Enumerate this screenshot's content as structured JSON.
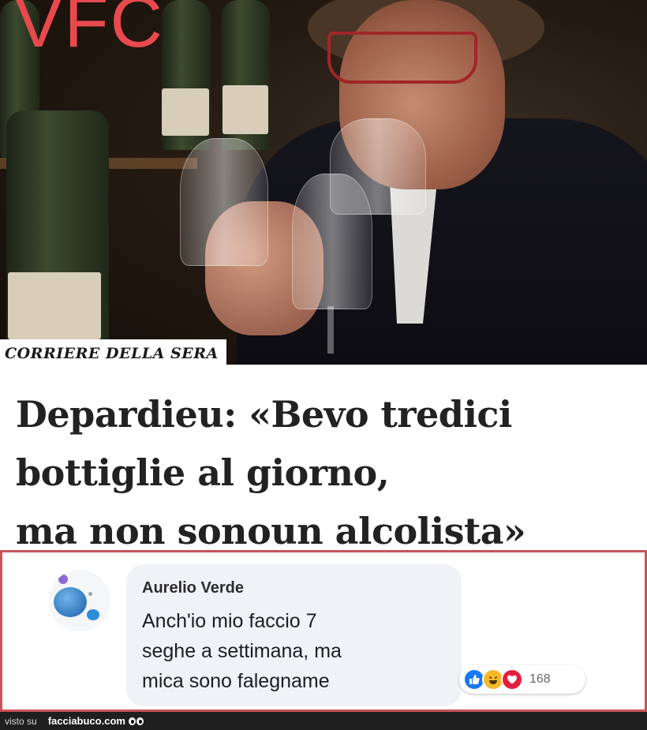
{
  "brand_mark": "VFC",
  "newspaper": "CORRIERE DELLA SERA",
  "headline": {
    "lines": [
      "Depardieu: «Bevo tredici",
      "bottiglie al giorno,",
      "ma non sonoun alcolista»"
    ]
  },
  "comment": {
    "author": "Aurelio Verde",
    "lines": [
      "Anch'io mio faccio 7",
      "seghe a settimana, ma",
      "mica sono falegname"
    ],
    "reactions": [
      "like",
      "haha",
      "love"
    ],
    "reaction_count": "168"
  },
  "footer": {
    "prefix": "visto su",
    "site": "facciabuco.com"
  },
  "colors": {
    "brand_mark": "#e8494f",
    "comment_border": "#c95457",
    "like": "#1877f2",
    "haha": "#f7b928",
    "love": "#e41e3f"
  }
}
